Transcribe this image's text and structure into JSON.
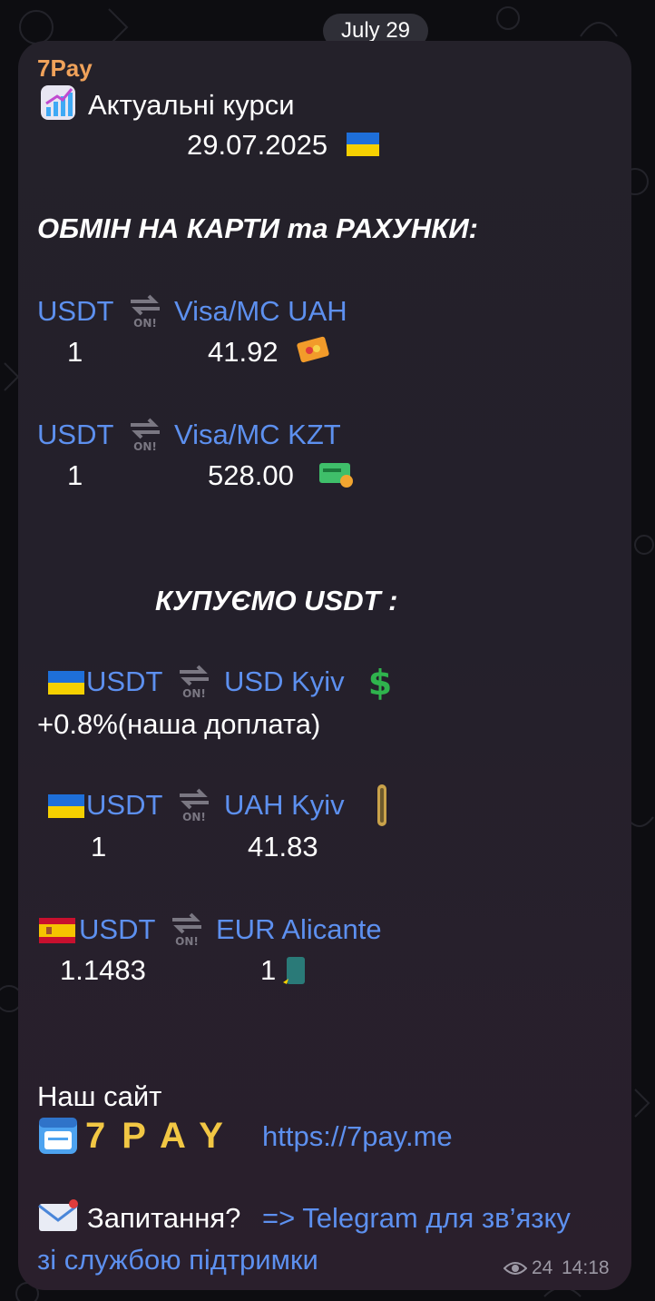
{
  "date_pill": "July 29",
  "message": {
    "sender": "7Pay",
    "title": "Актуальні курси",
    "date": "29.07.2025",
    "section_cards": "ОБМІН НА КАРТИ та РАХУНКИ:",
    "rows_cards": [
      {
        "from": "USDT",
        "to": "Visa/MC UAH",
        "left_value": "1",
        "right_value": "41.92"
      },
      {
        "from": "USDT",
        "to": "Visa/MC KZT",
        "left_value": "1",
        "right_value": "528.00"
      }
    ],
    "section_buy": "КУПУЄМО USDT :",
    "rows_buy": [
      {
        "from": "USDT",
        "to": "USD Kyiv",
        "note": "+0.8%(наша доплата)"
      },
      {
        "from": "USDT",
        "to": "UAH Kyiv",
        "left_value": "1",
        "right_value": "41.83"
      },
      {
        "from": "USDT",
        "to": "EUR Alicante",
        "left_value": "1.1483",
        "right_value": "1"
      }
    ],
    "site_label": "Наш сайт",
    "brand_letters": [
      "7",
      "P",
      "A",
      "Y"
    ],
    "site_url": "https://7pay.me",
    "question_label": "Запитання?",
    "support_link_line1": "=> Telegram для зв’язку",
    "support_link_line2": "зі службою підтримки",
    "views": "24",
    "time": "14:18"
  },
  "colors": {
    "sender": "#f0a25a",
    "link": "#5d90ef",
    "bubble": "#24212a",
    "background": "#0d0d11"
  },
  "icons": [
    "chart-up-icon",
    "ukraine-flag-icon",
    "swap-on-icon",
    "card-icon",
    "money-card-icon",
    "dollar-icon",
    "coin-icon",
    "spain-flag-icon",
    "euro-note-icon",
    "browser-icon",
    "envelope-icon",
    "eye-icon"
  ]
}
